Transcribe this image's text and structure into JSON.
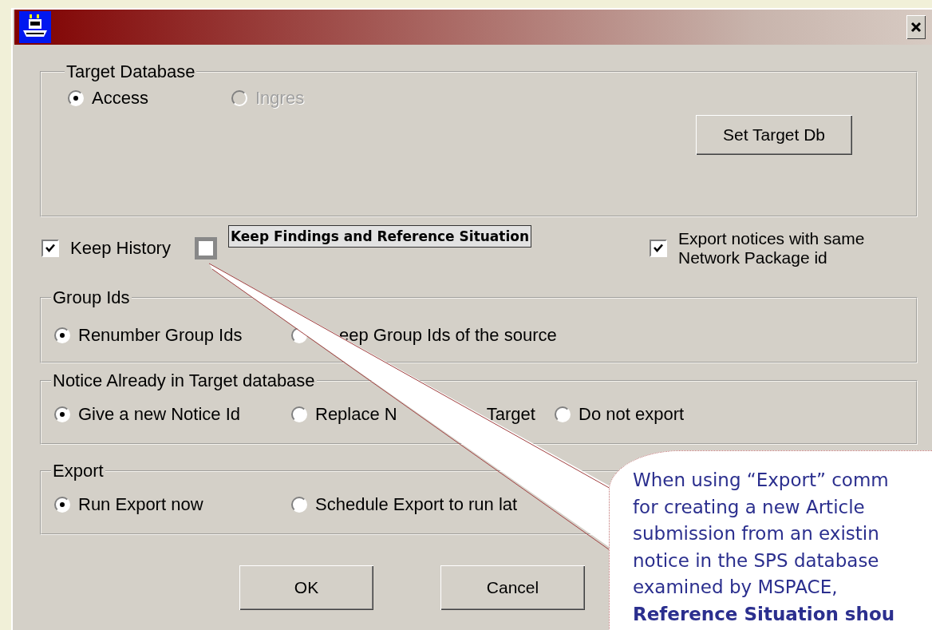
{
  "target_database": {
    "legend": "Target Database",
    "options": [
      {
        "label": "Access",
        "selected": true,
        "disabled": false
      },
      {
        "label": "Ingres",
        "selected": false,
        "disabled": true
      }
    ],
    "button": "Set Target Db"
  },
  "options_row": [
    {
      "kind": "checkbox",
      "label": "Keep History",
      "checked": true
    },
    {
      "kind": "annotated",
      "checked": false,
      "annotation": "Keep Findings and Reference Situation"
    },
    {
      "kind": "checkbox",
      "label": "Export notices with same Network Package id",
      "checked": true
    }
  ],
  "groups": [
    {
      "legend": "Group Ids",
      "options": [
        {
          "label_parts": [
            "Renumber Group Ids"
          ],
          "selected": true
        },
        {
          "label_parts": [
            "eep Group Ids of the source"
          ],
          "selected": false
        }
      ]
    },
    {
      "legend": "Notice Already in Target database",
      "options": [
        {
          "label_parts": [
            "Give a new Notice Id"
          ],
          "selected": true
        },
        {
          "label_parts": [
            "Replace N",
            "Target"
          ],
          "selected": false
        },
        {
          "label_parts": [
            "Do not export"
          ],
          "selected": false
        }
      ]
    },
    {
      "legend": "Export",
      "options": [
        {
          "label_parts": [
            "Run Export now"
          ],
          "selected": true
        },
        {
          "label_parts": [
            "Schedule Export to run lat"
          ],
          "selected": false
        }
      ]
    }
  ],
  "buttons": [
    "OK",
    "Cancel"
  ],
  "callout": {
    "lines": [
      {
        "text": "When using “Export” comm",
        "bold": false
      },
      {
        "text": "for creating a new Article",
        "bold": false
      },
      {
        "text": "submission from an existin",
        "bold": false
      },
      {
        "text": "notice in the SPS database",
        "bold": false
      },
      {
        "text": "examined by MSPACE,",
        "bold": false
      },
      {
        "text": "Reference Situation shou",
        "bold": true
      }
    ]
  }
}
